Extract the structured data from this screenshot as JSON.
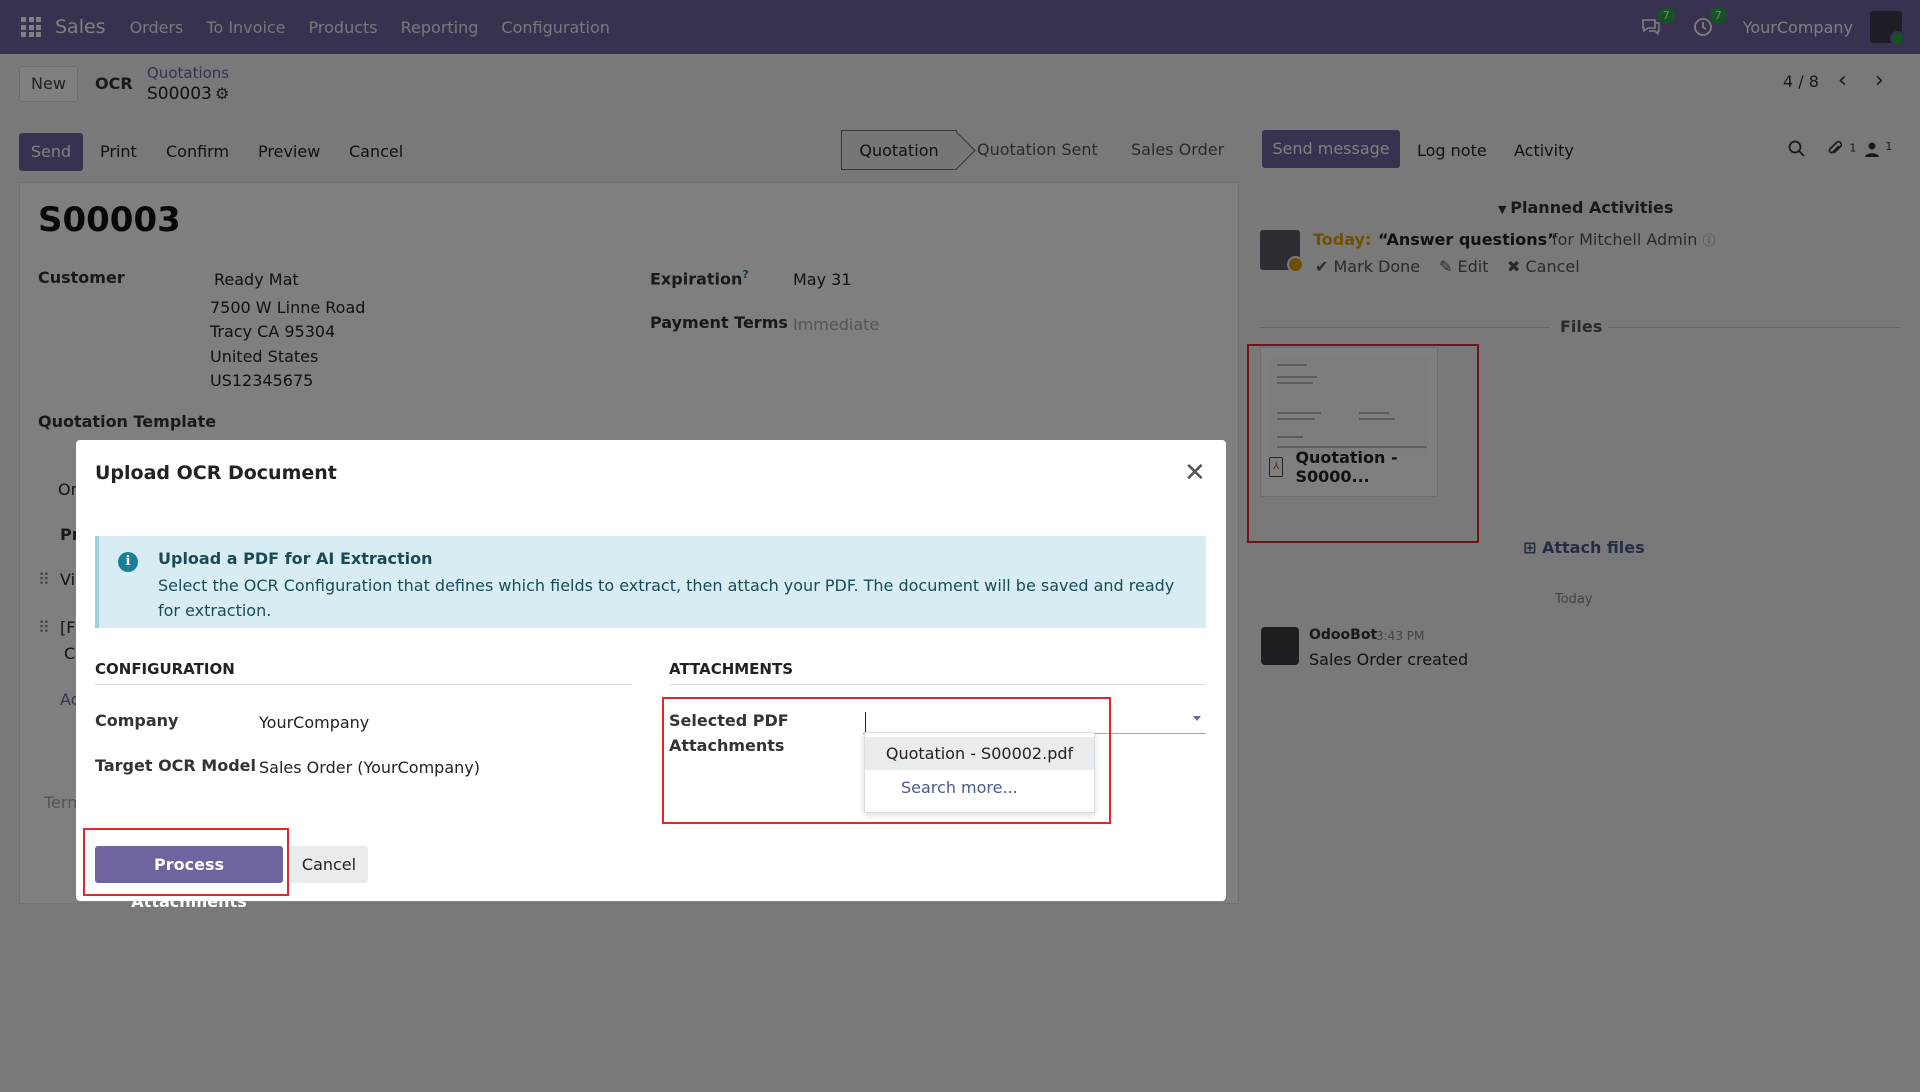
{
  "navbar": {
    "brand": "Sales",
    "menu": [
      "Orders",
      "To Invoice",
      "Products",
      "Reporting",
      "Configuration"
    ],
    "messages_count": "7",
    "activities_count": "7",
    "company": "YourCompany"
  },
  "control_panel": {
    "new_label": "New",
    "ocr_label": "OCR",
    "breadcrumb": "Quotations",
    "record_name": "S00003",
    "pager": "4 / 8"
  },
  "actions": {
    "send": "Send",
    "print": "Print",
    "confirm": "Confirm",
    "preview": "Preview",
    "cancel": "Cancel"
  },
  "statusbar": {
    "stages": [
      "Quotation",
      "Quotation Sent",
      "Sales Order"
    ],
    "active": "Quotation"
  },
  "form": {
    "title": "S00003",
    "customer_label": "Customer",
    "customer_name": "Ready Mat",
    "address": [
      "7500 W Linne Road",
      "Tracy CA 95304",
      "United States",
      "US12345675"
    ],
    "expiration_label": "Expiration",
    "expiration_help": "?",
    "expiration_value": "May 31",
    "payment_terms_label": "Payment Terms",
    "payment_terms_placeholder": "Immediate",
    "template_label": "Quotation Template",
    "partial_texts": [
      "Or",
      "Pr",
      "Vi",
      "[F",
      "C",
      "Ac",
      "Term"
    ]
  },
  "chatter": {
    "send_message": "Send message",
    "log_note": "Log note",
    "activity": "Activity",
    "attachments_count": "1",
    "followers_count": "1",
    "planned_activities": "Planned Activities",
    "activity_today": "Today:",
    "activity_title": "“Answer questions”",
    "activity_for": "for Mitchell Admin",
    "mark_done": "Mark Done",
    "edit": "Edit",
    "cancel": "Cancel",
    "files_label": "Files",
    "file_name": "Quotation - S0000...",
    "attach_files": "Attach files",
    "today_separator": "Today",
    "bot_name": "OdooBot",
    "bot_time": "3:43 PM",
    "bot_message": "Sales Order created"
  },
  "modal": {
    "title": "Upload OCR Document",
    "alert_title": "Upload a PDF for AI Extraction",
    "alert_body": "Select the OCR Configuration that defines which fields to extract, then attach your PDF. The document will be saved and ready for extraction.",
    "config_section": "CONFIGURATION",
    "attachments_section": "ATTACHMENTS",
    "company_label": "Company",
    "company_value": "YourCompany",
    "target_label": "Target OCR Model",
    "target_value": "Sales Order (YourCompany)",
    "selected_label_1": "Selected PDF",
    "selected_label_2": "Attachments",
    "dropdown_option": "Quotation - S00002.pdf",
    "search_more": "Search more...",
    "process_button": "Process Attachments",
    "cancel_button": "Cancel"
  },
  "colors": {
    "brand": "#71639e",
    "highlight": "#e3262e",
    "alert_bg": "#d8edf3"
  }
}
